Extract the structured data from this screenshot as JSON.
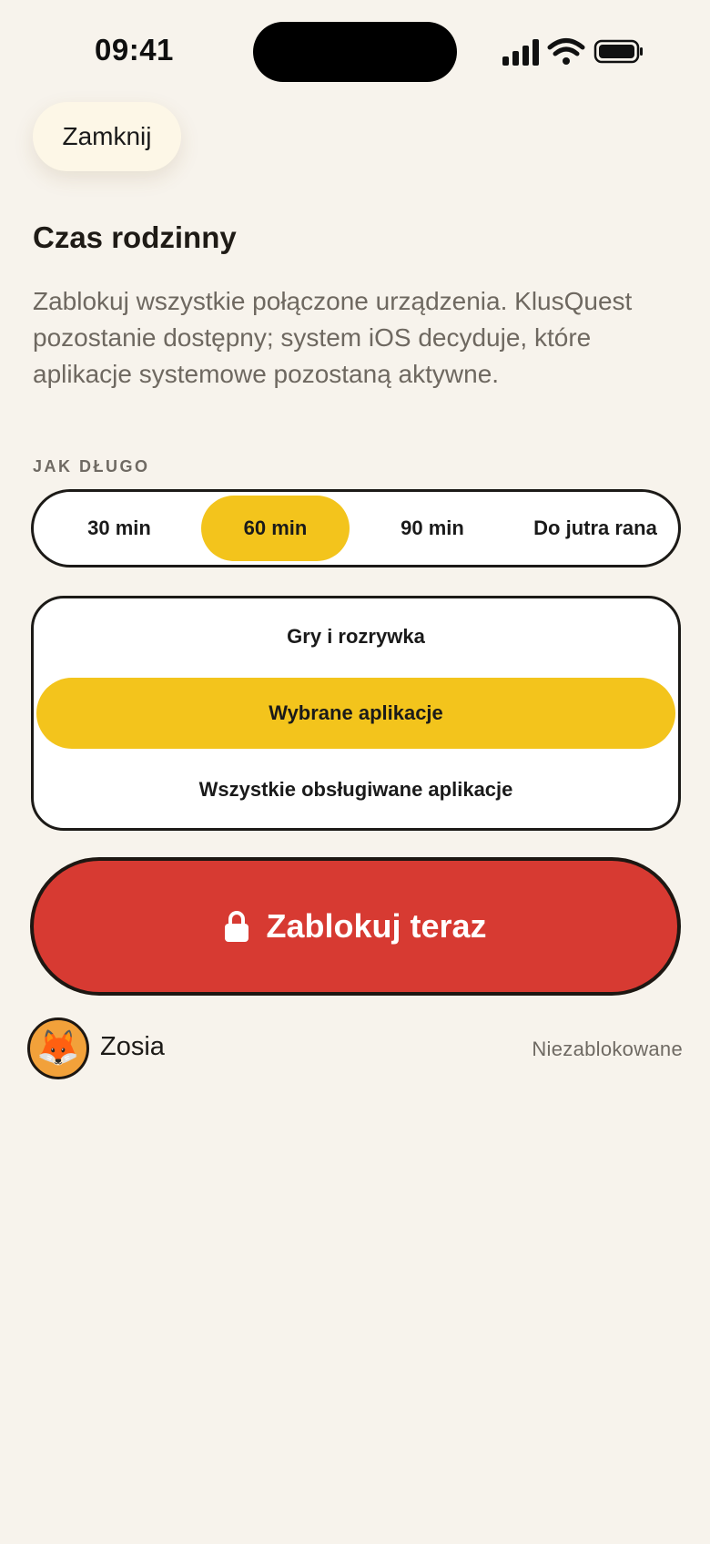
{
  "status_bar": {
    "time": "09:41",
    "icons": [
      "cellular-signal-icon",
      "wifi-icon",
      "battery-icon"
    ]
  },
  "header": {
    "close_label": "Zamknij"
  },
  "title": "Czas rodzinny",
  "description": "Zablokuj wszystkie połączone urządzenia. KlusQuest pozostanie dostępny; system iOS decyduje, które aplikacje systemowe pozostaną aktywne.",
  "duration": {
    "label": "JAK DŁUGO",
    "options": [
      "30 min",
      "60 min",
      "90 min",
      "Do jutra rana"
    ],
    "selected": "60 min"
  },
  "scope": {
    "options": [
      "Gry i rozrywka",
      "Wybrane aplikacje",
      "Wszystkie obsługiwane aplikacje"
    ],
    "selected": "Wybrane aplikacje"
  },
  "action": {
    "label": "Zablokuj teraz",
    "icon": "lock-icon"
  },
  "children": [
    {
      "name": "Zosia",
      "avatar": "🦊",
      "status": "Niezablokowane"
    }
  ],
  "colors": {
    "background": "#f7f3ec",
    "accent_yellow": "#f3c41c",
    "action_red": "#d73a32",
    "outline": "#1c1a17",
    "muted_text": "#6e6860"
  }
}
